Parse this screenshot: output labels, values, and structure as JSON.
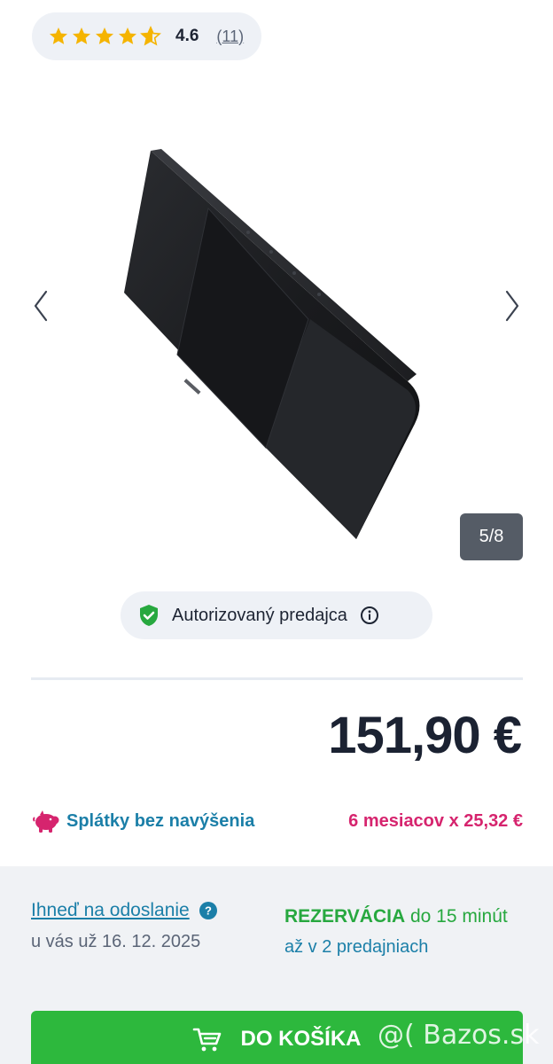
{
  "rating": {
    "stars": 4.6,
    "value_text": "4.6",
    "count_text": "(11)",
    "star_color": "#f5b400"
  },
  "gallery": {
    "counter": "5/8",
    "prev_icon": "chevron-left-icon",
    "next_icon": "chevron-right-icon"
  },
  "seller": {
    "label": "Autorizovaný predajca",
    "badge_color": "#27a83f"
  },
  "price": {
    "amount": "151,90 €"
  },
  "installments": {
    "label": "Splátky bez navýšenia",
    "value": "6 mesiacov x 25,32 €",
    "icon": "piggy-bank-icon"
  },
  "shipping": {
    "link": "Ihneď na odoslanie",
    "date": "u vás už 16. 12. 2025"
  },
  "reservation": {
    "strong": "REZERVÁCIA",
    "rest": " do 15 minút",
    "stores": "až v 2 predajniach"
  },
  "cart": {
    "label": "DO KOŠÍKA",
    "color": "#2db83d"
  },
  "watermark": {
    "text": "@( Bazos.sk"
  }
}
